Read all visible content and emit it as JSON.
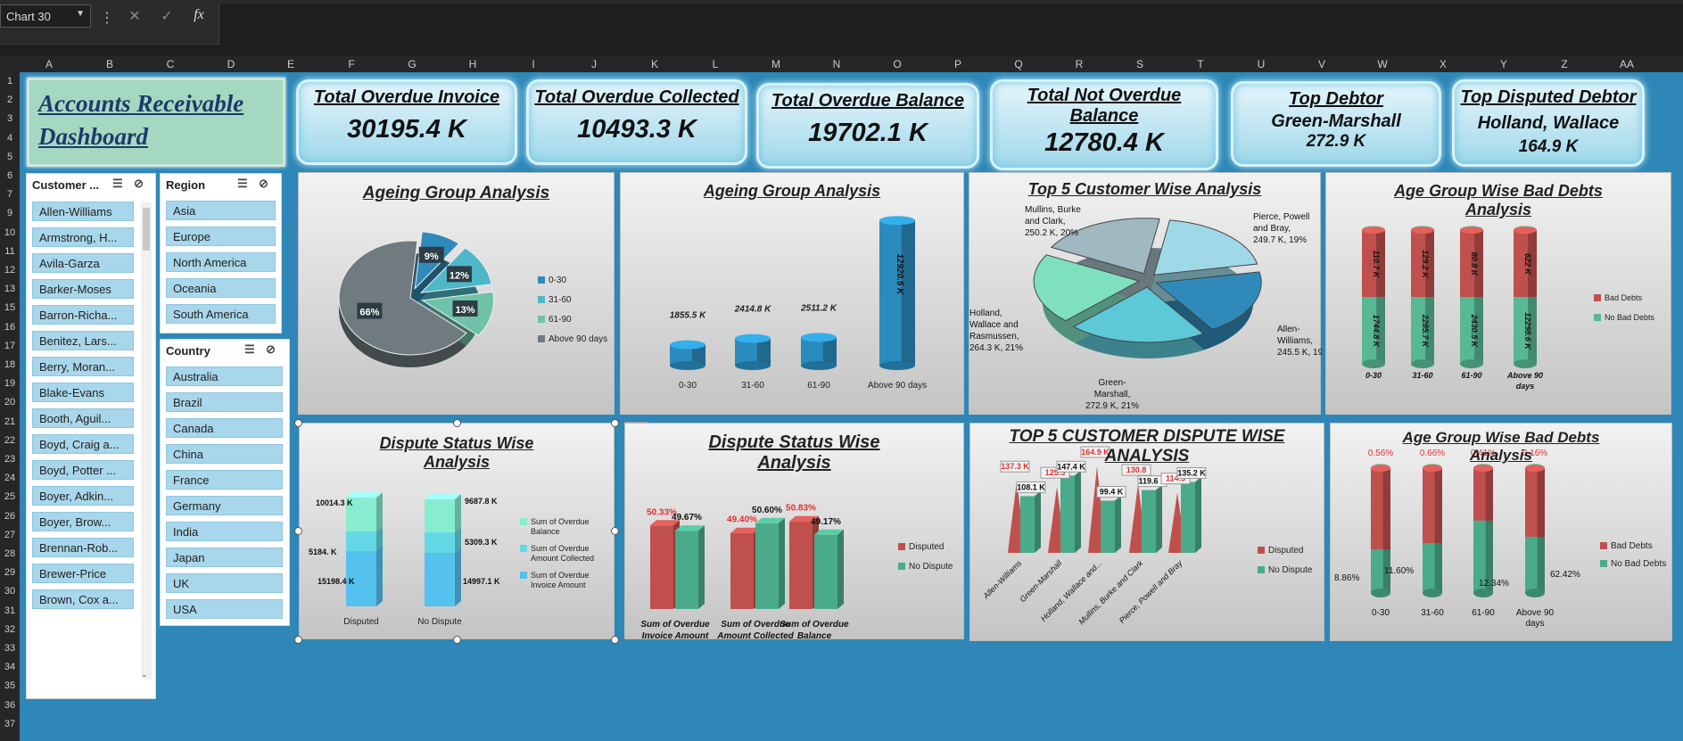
{
  "formula_bar": {
    "name_box": "Chart 30",
    "cancel_icon": "✕",
    "enter_icon": "✓",
    "fx_label": "fx"
  },
  "columns": [
    "A",
    "B",
    "C",
    "D",
    "E",
    "F",
    "G",
    "H",
    "I",
    "J",
    "K",
    "L",
    "M",
    "N",
    "O",
    "P",
    "Q",
    "R",
    "S",
    "T",
    "U",
    "V",
    "W",
    "X",
    "Y",
    "Z",
    "AA"
  ],
  "rows": [
    "1",
    "2",
    "3",
    "4",
    "5",
    "6",
    "7",
    "9",
    "10",
    "11",
    "12",
    "13",
    "15",
    "16",
    "17",
    "18",
    "19",
    "20",
    "21",
    "22",
    "23",
    "24",
    "25",
    "26",
    "27",
    "28",
    "29",
    "30",
    "31",
    "32",
    "33",
    "34",
    "35",
    "36",
    "37"
  ],
  "dashboard_title": "Accounts Receivable Dashboard",
  "kpis": {
    "overdue_invoice": {
      "label": "Total Overdue Invoice",
      "value": "30195.4 K"
    },
    "overdue_collected": {
      "label": "Total Overdue Collected",
      "value": "10493.3 K"
    },
    "overdue_balance": {
      "label": "Total Overdue Balance",
      "value": "19702.1 K"
    },
    "not_overdue": {
      "label": "Total Not Overdue Balance",
      "value": "12780.4 K"
    },
    "top_debtor": {
      "label": "Top Debtor",
      "name": "Green-Marshall",
      "value": "272.9 K"
    },
    "top_disputed": {
      "label": "Top Disputed Debtor",
      "name": "Holland, Wallace",
      "value": "164.9 K"
    }
  },
  "slicers": {
    "customer": {
      "title": "Customer ...",
      "items": [
        "Allen-Williams",
        "Armstrong, H...",
        "Avila-Garza",
        "Barker-Moses",
        "Barron-Richa...",
        "Benitez, Lars...",
        "Berry, Moran...",
        "Blake-Evans",
        "Booth, Aguil...",
        "Boyd, Craig a...",
        "Boyd, Potter ...",
        "Boyer, Adkin...",
        "Boyer, Brow...",
        "Brennan-Rob...",
        "Brewer-Price",
        "Brown, Cox a..."
      ]
    },
    "region": {
      "title": "Region",
      "items": [
        "Asia",
        "Europe",
        "North America",
        "Oceania",
        "South America"
      ]
    },
    "country": {
      "title": "Country",
      "items": [
        "Australia",
        "Brazil",
        "Canada",
        "China",
        "France",
        "Germany",
        "India",
        "Japan",
        "UK",
        "USA"
      ]
    }
  },
  "chart_data": [
    {
      "type": "pie",
      "title": "Ageing Group Analysis",
      "categories": [
        "0-30",
        "31-60",
        "61-90",
        "Above 90 days"
      ],
      "values": [
        9,
        12,
        13,
        66
      ],
      "data_labels": [
        "9%",
        "12%",
        "13%",
        "66%"
      ],
      "legend_position": "right",
      "colors": [
        "#2f8ab9",
        "#4fb8c8",
        "#6fc2a8",
        "#707b7f"
      ]
    },
    {
      "type": "bar",
      "title": "Ageing Group Analysis",
      "categories": [
        "0-30",
        "31-60",
        "61-90",
        "Above 90 days"
      ],
      "values": [
        1855.5,
        2414.8,
        2511.2,
        12920.5
      ],
      "data_labels": [
        "1855.5 K",
        "2414.8 K",
        "2511.2 K",
        "12920.5 K"
      ],
      "color": "#2a8bbd"
    },
    {
      "type": "pie",
      "title": "Top 5 Customer Wise Analysis",
      "categories": [
        "Pierce, Powell and Bray",
        "Allen-Williams",
        "Green-Marshall",
        "Holland, Wallace and Rasmussen",
        "Mullins, Burke and Clark"
      ],
      "values": [
        249.7,
        245.5,
        272.9,
        264.3,
        250.2
      ],
      "data_labels": [
        "Pierce, Powell and Bray, 249.7 K, 19%",
        "Allen-Williams, 245.5 K, 19%",
        "Green-Marshall, 272.9 K, 21%",
        "Holland, Wallace and Rasmussen, 264.3 K, 21%",
        "Mullins, Burke and Clark, 250.2 K, 20%"
      ],
      "colors": [
        "#9fd9e8",
        "#2f8ab9",
        "#5cc8d8",
        "#7ee0bf",
        "#a0b8c0"
      ]
    },
    {
      "type": "bar",
      "title": "Age Group Wise Bad Debts Analysis",
      "stacked": true,
      "categories": [
        "0-30",
        "31-60",
        "61-90",
        "Above 90 days"
      ],
      "series": [
        {
          "name": "Bad Debts",
          "values": [
            110.7,
            129.2,
            80.8,
            622
          ],
          "labels": [
            "110.7 K",
            "129.2 K",
            "80.8 K",
            "622 K"
          ]
        },
        {
          "name": "No Bad Debts",
          "values": [
            1744.8,
            2285.7,
            2430.5,
            12298.6
          ],
          "labels": [
            "1744.8 K",
            "2285.7 K",
            "2430.5 K",
            "12298.6 K"
          ]
        }
      ],
      "legend_position": "right",
      "colors": [
        "#c0504d",
        "#58b894"
      ]
    },
    {
      "type": "bar",
      "title": "Dispute Status Wise Analysis",
      "stacked": true,
      "categories": [
        "Disputed",
        "No Dispute"
      ],
      "series": [
        {
          "name": "Sum of Overdue Invoice Amount",
          "values": [
            15198.4,
            14997.1
          ],
          "labels": [
            "15198.4 K",
            "14997.1 K"
          ]
        },
        {
          "name": "Sum of Overdue Amount Collected",
          "values": [
            5184.0,
            5309.3
          ],
          "labels": [
            "5184. K",
            "5309.3 K"
          ]
        },
        {
          "name": "Sum of Overdue Balance",
          "values": [
            10014.3,
            9687.8
          ],
          "labels": [
            "10014.3 K",
            "9687.8 K"
          ]
        }
      ],
      "legend_position": "right",
      "colors": [
        "#55c1ee",
        "#63d8e4",
        "#88ecd0"
      ]
    },
    {
      "type": "bar",
      "title": "Dispute Status Wise Analysis",
      "categories": [
        "Sum of Overdue Invoice Amount",
        "Sum of Overdue Amount Collected",
        "Sum of Overdue Balance"
      ],
      "series": [
        {
          "name": "Disputed",
          "values": [
            50.33,
            49.4,
            50.83
          ],
          "labels": [
            "50.33%",
            "49.40%",
            "50.83%"
          ]
        },
        {
          "name": "No Dispute",
          "values": [
            49.67,
            50.6,
            49.17
          ],
          "labels": [
            "49.67%",
            "50.60%",
            "49.17%"
          ]
        }
      ],
      "legend_position": "right",
      "colors": [
        "#c0504d",
        "#4aab8a"
      ]
    },
    {
      "type": "bar",
      "title": "TOP 5 CUSTOMER DISPUTE WISE ANALYSIS",
      "categories": [
        "Allen-Williams",
        "Green-Marshall",
        "Holland, Wallace and...",
        "Mullins, Burke and Clark",
        "Pierce, Powell and Bray"
      ],
      "series": [
        {
          "name": "Disputed",
          "values": [
            137.3,
            125.5,
            164.9,
            130.8,
            114.5
          ],
          "labels": [
            "137.3 K",
            "125.5",
            "164.9 K",
            "130.8",
            "114.5"
          ]
        },
        {
          "name": "No Dispute",
          "values": [
            108.1,
            147.4,
            99.4,
            119.6,
            135.2
          ],
          "labels": [
            "108.1 K",
            "147.4 K",
            "99.4 K",
            "119.6 K",
            "135.2 K"
          ]
        }
      ],
      "legend_position": "right",
      "colors": [
        "#c0504d",
        "#4aab8a"
      ]
    },
    {
      "type": "bar",
      "title": "Age Group Wise Bad Debts Analysis",
      "stacked": true,
      "categories": [
        "0-30",
        "31-60",
        "61-90",
        "Above 90 days"
      ],
      "series": [
        {
          "name": "Bad Debts",
          "values": [
            0.56,
            0.66,
            0.41,
            3.16
          ],
          "labels": [
            "0.56%",
            "0.66%",
            "0.41%",
            "3.16%"
          ]
        },
        {
          "name": "No Bad Debts",
          "values": [
            8.86,
            11.6,
            12.34,
            62.42
          ],
          "labels": [
            "8.86%",
            "11.60%",
            "12.34%",
            "62.42%"
          ]
        }
      ],
      "legend_position": "right",
      "colors": [
        "#c0504d",
        "#4aab8a"
      ]
    }
  ]
}
